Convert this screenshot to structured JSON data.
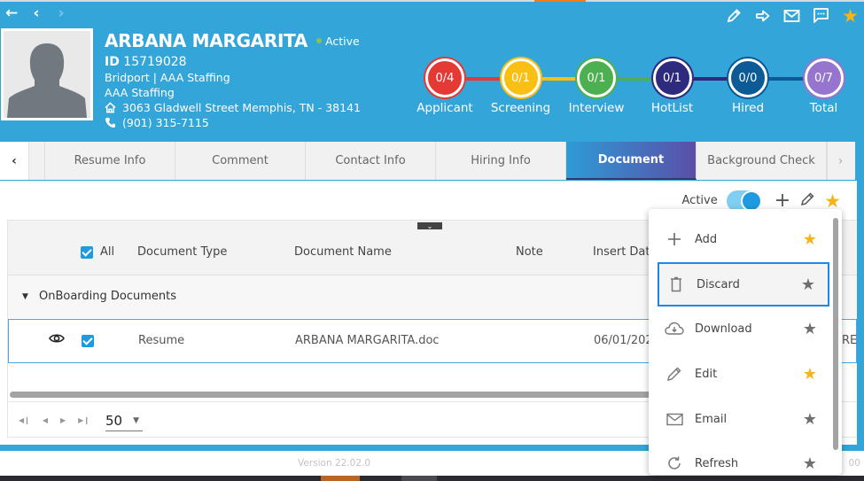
{
  "header": {
    "nav": {
      "back_icon": "arrow-left-icon",
      "prev_icon": "chevron-left-icon",
      "next_icon": "chevron-right-icon"
    },
    "candidate": {
      "name": "ARBANA MARGARITA",
      "status": "Active",
      "id_label": "ID",
      "id_value": "15719028",
      "company_line": "Bridport | AAA Staffing",
      "agency": "AAA Staffing",
      "address": "3063 Gladwell Street Memphis, TN - 38141",
      "phone": "(901) 315-7115"
    },
    "actions": [
      "pencil-icon",
      "forward-arrow-icon",
      "envelope-icon",
      "chat-icon",
      "star-icon"
    ],
    "pipeline": [
      {
        "label": "Applicant",
        "value": "0/4",
        "color": "#e53935"
      },
      {
        "label": "Screening",
        "value": "0/1",
        "color": "#f9c013"
      },
      {
        "label": "Interview",
        "value": "0/1",
        "color": "#4caf50"
      },
      {
        "label": "HotList",
        "value": "0/1",
        "color": "#2e2a7d"
      },
      {
        "label": "Hired",
        "value": "0/0",
        "color": "#0c5a96"
      },
      {
        "label": "Total",
        "value": "0/7",
        "color": "#9575cd"
      }
    ]
  },
  "tabs": {
    "items": [
      "Resume Info",
      "Comment",
      "Contact Info",
      "Hiring Info",
      "Document",
      "Background Check"
    ],
    "active": "Document"
  },
  "toolbar": {
    "active_label": "Active",
    "active_toggle_on": true
  },
  "grid": {
    "select_all_label": "All",
    "columns": [
      "Document Type",
      "Document Name",
      "Note",
      "Insert Date"
    ],
    "group": "OnBoarding Documents",
    "rows": [
      {
        "document_type": "Resume",
        "document_name": "ARBANA MARGARITA.doc",
        "note": "",
        "insert_date": "06/01/202",
        "overflow": "RE"
      }
    ],
    "page_size": "50"
  },
  "menu": {
    "items": [
      {
        "label": "Add",
        "icon": "plus-icon",
        "starred": true
      },
      {
        "label": "Discard",
        "icon": "trash-icon",
        "starred": false,
        "selected": true
      },
      {
        "label": "Download",
        "icon": "cloud-download-icon",
        "starred": false
      },
      {
        "label": "Edit",
        "icon": "pencil-icon",
        "starred": true
      },
      {
        "label": "Email",
        "icon": "envelope-icon",
        "starred": false
      },
      {
        "label": "Refresh",
        "icon": "refresh-icon",
        "starred": false
      }
    ]
  },
  "footer": {
    "version": "Version 22.02.0",
    "right_fragment": "00"
  }
}
